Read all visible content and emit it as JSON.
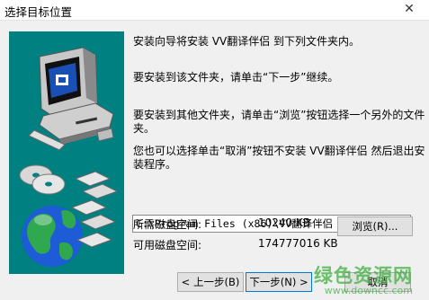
{
  "window": {
    "title": "选择目标位置",
    "close_glyph": "✕"
  },
  "messages": {
    "line1": "安装向导将安装 VV翻译伴侣 到下列文件夹内。",
    "line2": "要安装到该文件夹，请单击“下一步”继续。",
    "line3": "要安装到其他文件夹，请单击“浏览”按钮选择一个另外的文件夹。",
    "line4": "您也可以选择单击“取消”按钮不安装 VV翻译伴侣 然后退出安装程序。"
  },
  "destination": {
    "path": "C:\\Program Files (x86)\\VV翻译伴侣"
  },
  "space": {
    "required_label": "所需磁盘空间:",
    "required_value": "10240 KB",
    "available_label": "可用磁盘空间:",
    "available_value": "174777016 KB"
  },
  "buttons": {
    "browse": "浏览(R)...",
    "back": "< 上一步(B)",
    "next": "下一步(N) >",
    "cancel": "取消"
  },
  "watermark": {
    "text": "绿色资源网",
    "url": "www.downcc.com"
  },
  "colors": {
    "art_background": "#008080",
    "default_button_border": "#0078d7",
    "watermark": "#3fae3f"
  },
  "icons": {
    "art": [
      "computer-icon",
      "cd-discs-icon",
      "globe-icon",
      "floppy-disks-icon"
    ]
  }
}
